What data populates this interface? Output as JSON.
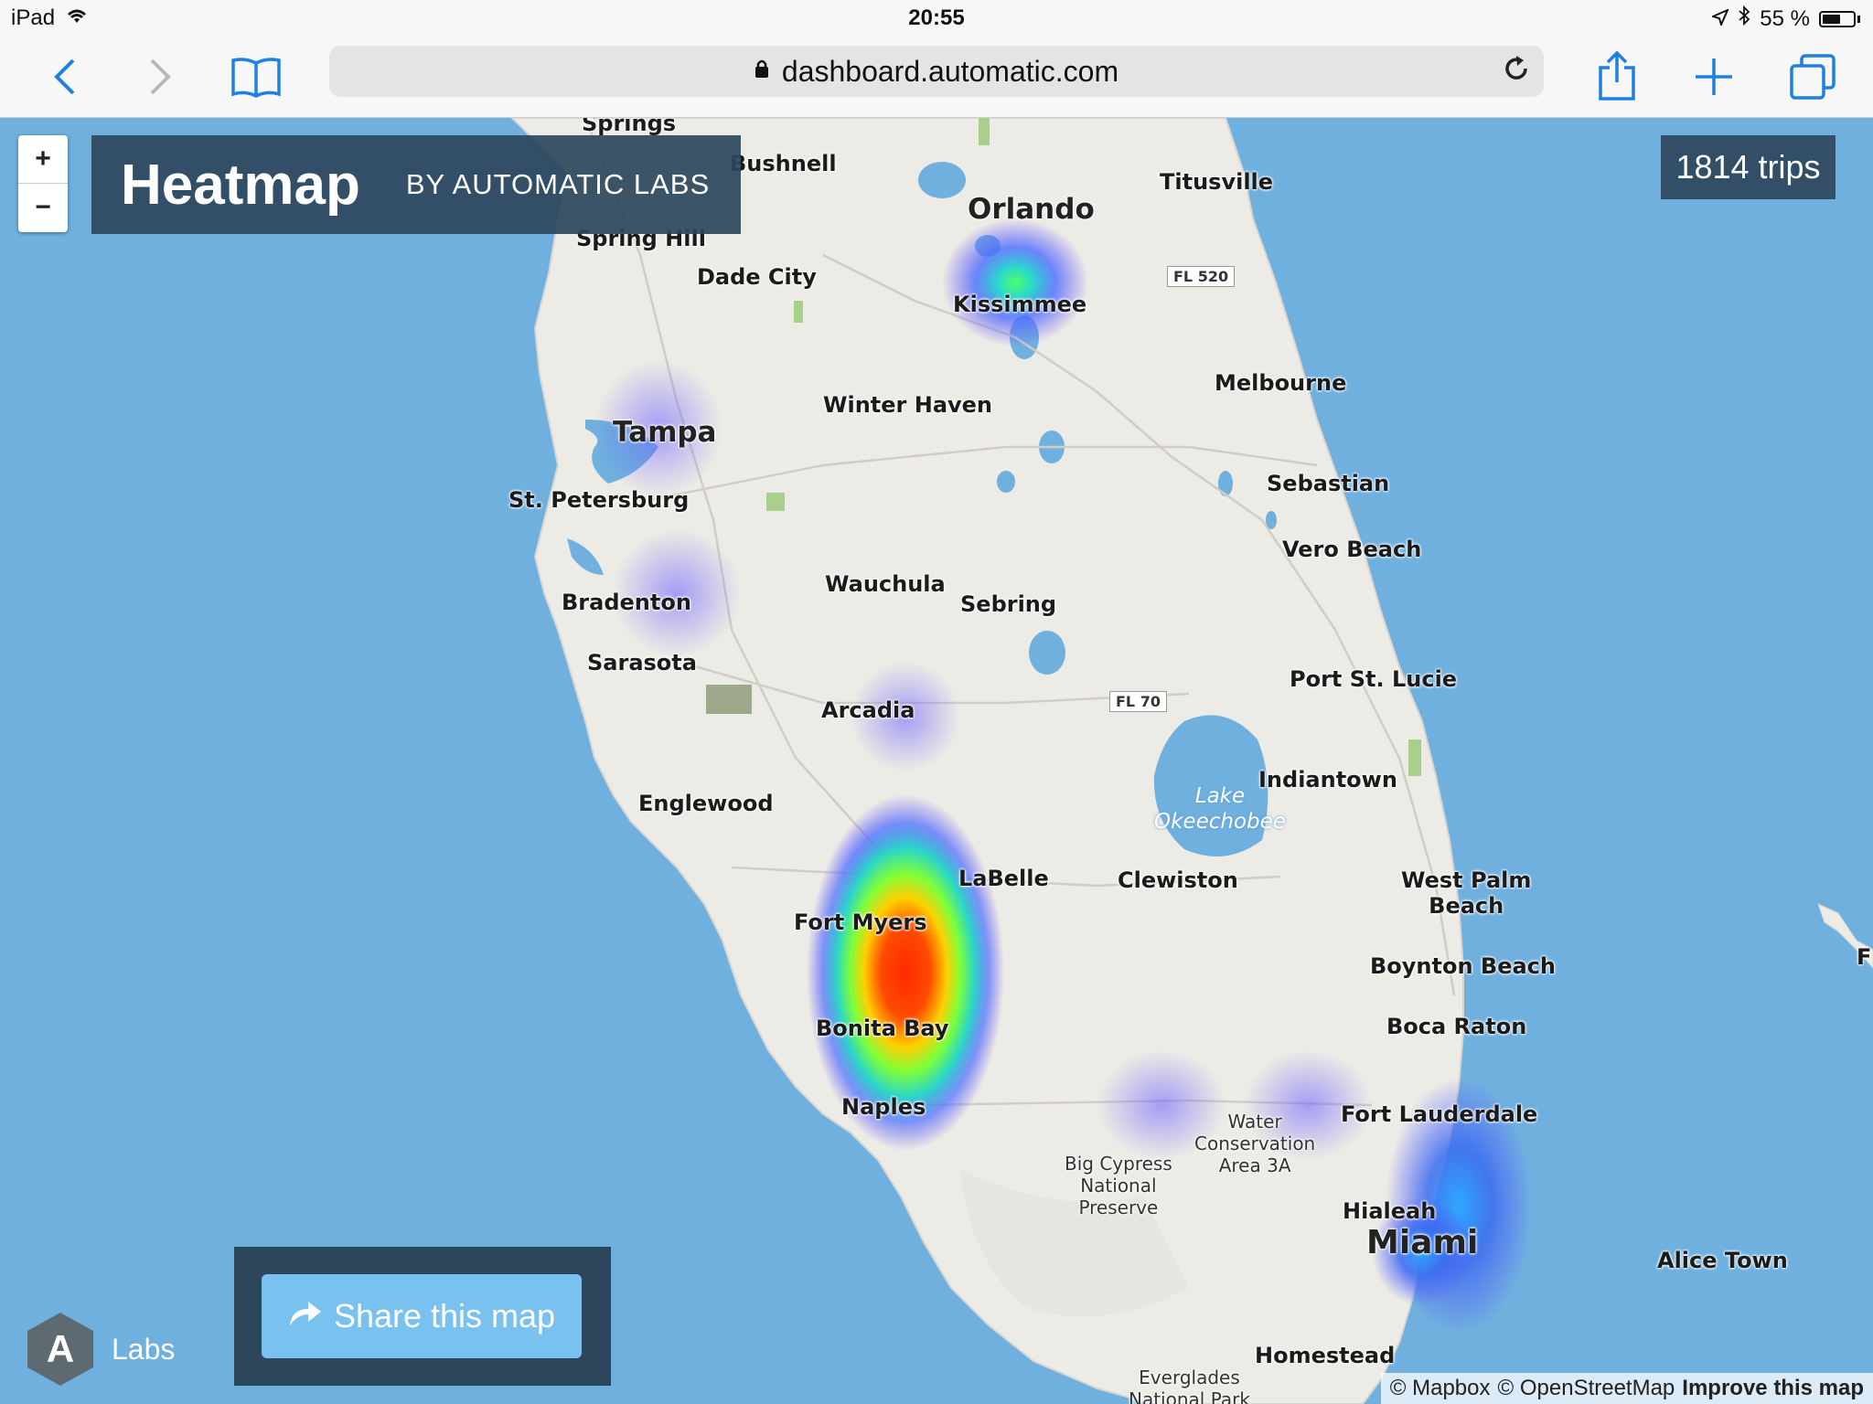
{
  "status_bar": {
    "device": "iPad",
    "time": "20:55",
    "battery": "55 %"
  },
  "browser": {
    "url": "dashboard.automatic.com"
  },
  "map": {
    "title": "Heatmap",
    "subtitle": "BY AUTOMATIC LABS",
    "trips": "1814 trips",
    "zoom_in": "+",
    "zoom_out": "−",
    "share_label": "Share this map",
    "labs_label": "Labs",
    "labs_logo": "A",
    "attribution": {
      "mapbox": "© Mapbox",
      "osm": "© OpenStreetMap",
      "improve": "Improve this map"
    },
    "labels": {
      "springs": "Springs",
      "bushnell": "Bushnell",
      "spring_hill": "Spring Hill",
      "dade_city": "Dade City",
      "orlando": "Orlando",
      "titusville": "Titusville",
      "kissimmee": "Kissimmee",
      "fl520": "FL 520",
      "melbourne": "Melbourne",
      "tampa": "Tampa",
      "winter_haven": "Winter Haven",
      "st_petersburg": "St. Petersburg",
      "sebastian": "Sebastian",
      "vero_beach": "Vero Beach",
      "bradenton": "Bradenton",
      "wauchula": "Wauchula",
      "sebring": "Sebring",
      "sarasota": "Sarasota",
      "port_st_lucie": "Port St. Lucie",
      "fl70": "FL 70",
      "arcadia": "Arcadia",
      "lake_line1": "Lake",
      "lake_line2": "Okeechobee",
      "indiantown": "Indiantown",
      "englewood": "Englewood",
      "labelle": "LaBelle",
      "clewiston": "Clewiston",
      "west_palm_1": "West Palm",
      "west_palm_2": "Beach",
      "fort_myers": "Fort Myers",
      "boynton_beach": "Boynton Beach",
      "bonita_bay": "Bonita Bay",
      "boca_raton": "Boca Raton",
      "naples": "Naples",
      "fort_lauderdale": "Fort Lauderdale",
      "water_cons_1": "Water",
      "water_cons_2": "Conservation",
      "water_cons_3": "Area 3A",
      "big_cypress_1": "Big Cypress",
      "big_cypress_2": "National",
      "big_cypress_3": "Preserve",
      "hialeah": "Hialeah",
      "miami": "Miami",
      "alice_town": "Alice Town",
      "homestead": "Homestead",
      "everglades_1": "Everglades",
      "everglades_2": "National Park",
      "edge_f": "F"
    }
  }
}
